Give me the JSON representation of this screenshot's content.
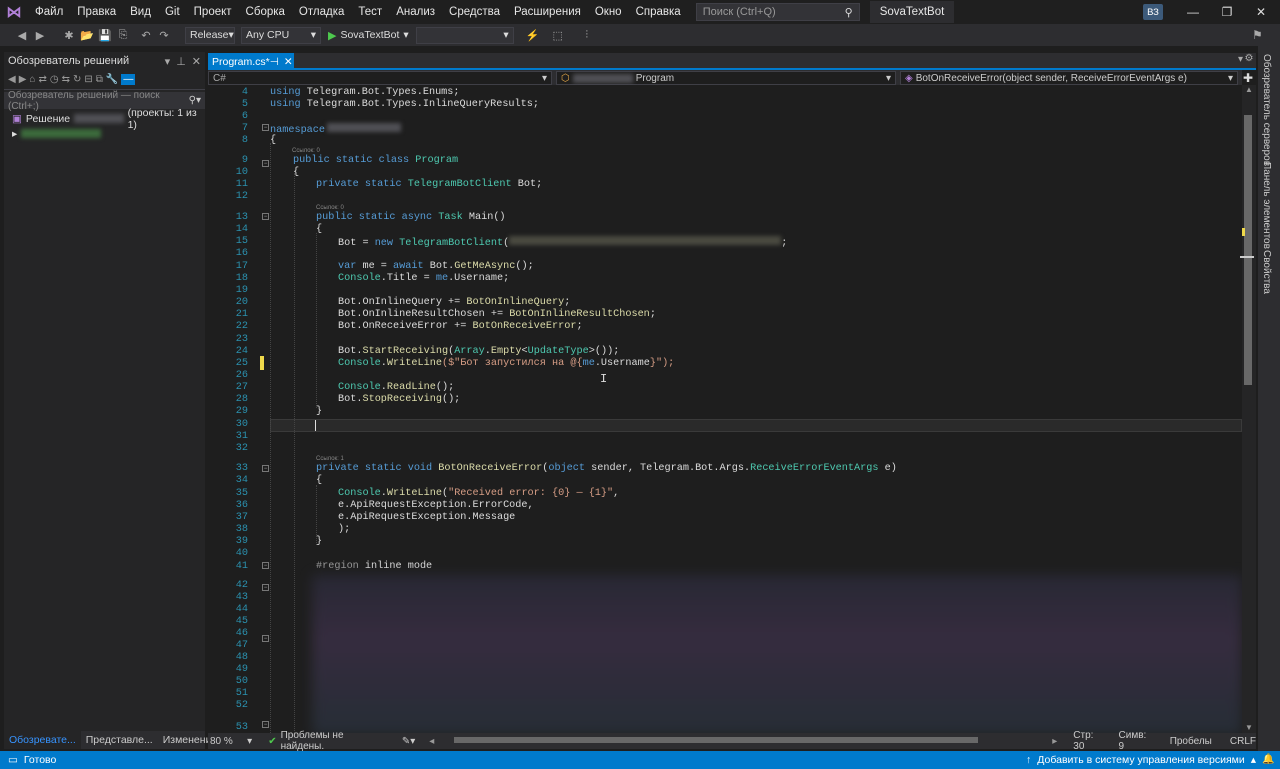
{
  "menu": {
    "items": [
      "Файл",
      "Правка",
      "Вид",
      "Git",
      "Проект",
      "Сборка",
      "Отладка",
      "Тест",
      "Анализ",
      "Средства",
      "Расширения",
      "Окно",
      "Справка"
    ],
    "search_placeholder": "Поиск (Ctrl+Q)",
    "project_title": "SovaTextBot",
    "account_initials": "ВЗ"
  },
  "toolbar": {
    "config": "Release",
    "platform": "Any CPU",
    "run_target": "SovaTextBot"
  },
  "solution_explorer": {
    "title": "Обозреватель решений",
    "search_placeholder": "Обозреватель решений — поиск (Ctrl+;)",
    "solution_label": "Решение",
    "solution_count": "(проекты: 1 из 1)",
    "bottom_tabs": [
      "Обозревате...",
      "Представле...",
      "Изменения..."
    ]
  },
  "editor": {
    "tab_label": "Program.cs*",
    "nav_class": "Program",
    "nav_member": "BotOnReceiveError(object sender, ReceiveErrorEventArgs e)",
    "codelens_0": "Ссылок: 0",
    "codelens_1": "Ссылок: 1",
    "line_numbers": [
      "4",
      "5",
      "6",
      "7",
      "8",
      "9",
      "10",
      "11",
      "12",
      "13",
      "14",
      "15",
      "16",
      "17",
      "18",
      "19",
      "20",
      "21",
      "22",
      "23",
      "24",
      "25",
      "26",
      "27",
      "28",
      "29",
      "30",
      "31",
      "32",
      "33",
      "34",
      "35",
      "36",
      "37",
      "38",
      "39",
      "40",
      "41",
      "42",
      "43",
      "44",
      "45",
      "46",
      "47",
      "48",
      "49",
      "50",
      "51",
      "52",
      "53"
    ]
  },
  "code": {
    "l4a": "using ",
    "l4b": "Telegram.Bot.Types.Enums;",
    "l5a": "using ",
    "l5b": "Telegram.Bot.Types.InlineQueryResults;",
    "l7": "namespace",
    "l8": "{",
    "l9a": "public static class ",
    "l9b": "Program",
    "l10": "{",
    "l11a": "private static ",
    "l11b": "TelegramBotClient",
    "l11c": " Bot;",
    "l13a": "public static async ",
    "l13b": "Task",
    "l13c": " Main()",
    "l14": "{",
    "l15a": "Bot = ",
    "l15b": "new ",
    "l15c": "TelegramBotClient",
    "l15d": "(",
    "l15e": ";",
    "l17a": "var ",
    "l17b": "me = ",
    "l17c": "await ",
    "l17d": "Bot.",
    "l17e": "GetMeAsync",
    "l17f": "();",
    "l18a": "Console",
    "l18b": ".Title = ",
    "l18c": "me",
    "l18d": ".Username;",
    "l20a": "Bot.OnInlineQuery += ",
    "l20b": "BotOnInlineQuery",
    "l20c": ";",
    "l21a": "Bot.OnInlineResultChosen += ",
    "l21b": "BotOnInlineResultChosen",
    "l21c": ";",
    "l22a": "Bot.OnReceiveError += ",
    "l22b": "BotOnReceiveError",
    "l22c": ";",
    "l24a": "Bot.",
    "l24b": "StartReceiving",
    "l24c": "(",
    "l24d": "Array",
    "l24e": ".",
    "l24f": "Empty",
    "l24g": "<",
    "l24h": "UpdateType",
    "l24i": ">());",
    "l25a": "Console",
    "l25b": ".",
    "l25c": "WriteLine",
    "l25d": "($\"Бот запустился на @{",
    "l25e": "me",
    "l25f": ".Username",
    "l25g": "}\");",
    "l27a": "Console",
    "l27b": ".",
    "l27c": "ReadLine",
    "l27d": "();",
    "l28a": "Bot.",
    "l28b": "StopReceiving",
    "l28c": "();",
    "l29": "}",
    "l33a": "private static void ",
    "l33b": "BotOnReceiveError",
    "l33c": "(",
    "l33d": "object ",
    "l33e": "sender, Telegram.Bot.Args.",
    "l33f": "ReceiveErrorEventArgs",
    "l33g": " e)",
    "l34": "{",
    "l35a": "Console",
    "l35b": ".",
    "l35c": "WriteLine",
    "l35d": "(",
    "l35e": "\"Received error: {0} — {1}\"",
    "l35f": ",",
    "l36": "e.ApiRequestException.ErrorCode,",
    "l37": "e.ApiRequestException.Message",
    "l38": ");",
    "l39": "}",
    "l41a": "#region ",
    "l41b": "inline mode"
  },
  "editor_status": {
    "zoom": "80 %",
    "issues": "Проблемы не найдены.",
    "line": "Стр: 30",
    "col": "Симв: 9",
    "spaces": "Пробелы",
    "eol": "CRLF"
  },
  "right_dock": {
    "tabs": [
      "Обозреватель серверов",
      "Панель элементов",
      "Свойства"
    ]
  },
  "status_bar": {
    "ready": "Готово",
    "source_control": "Добавить в систему управления версиями"
  }
}
